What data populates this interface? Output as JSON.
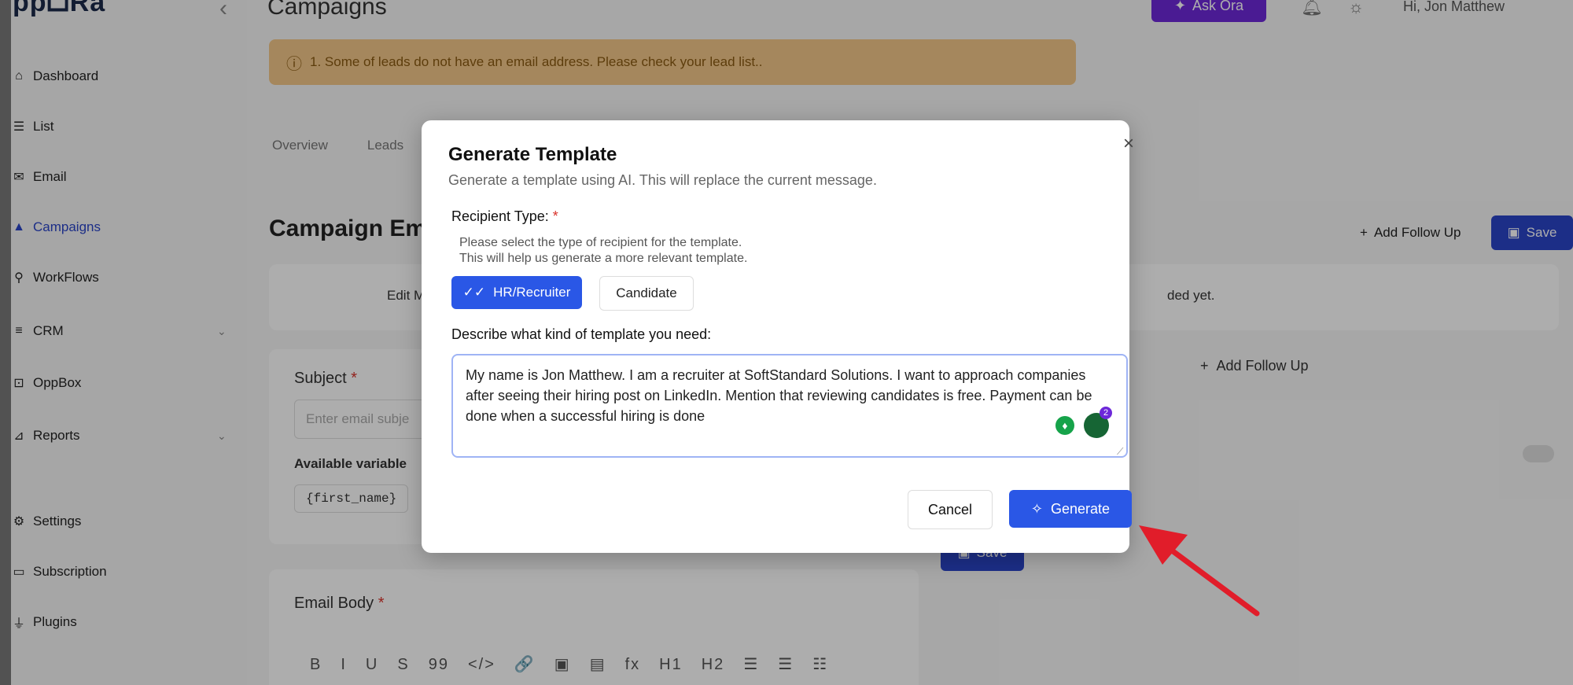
{
  "app": {
    "logo": "ppᗝRa",
    "collapse_icon": "chevron-left-icon"
  },
  "sidebar": {
    "items": [
      {
        "label": "Dashboard",
        "icon": "home-icon"
      },
      {
        "label": "List",
        "icon": "list-icon"
      },
      {
        "label": "Email",
        "icon": "mail-icon"
      },
      {
        "label": "Campaigns",
        "icon": "campaign-icon",
        "active": true
      },
      {
        "label": "WorkFlows",
        "icon": "workflow-icon"
      },
      {
        "label": "CRM",
        "icon": "crm-icon"
      },
      {
        "label": "OppBox",
        "icon": "inbox-icon"
      },
      {
        "label": "Reports",
        "icon": "reports-icon"
      },
      {
        "label": "Settings",
        "icon": "gear-icon"
      },
      {
        "label": "Subscription",
        "icon": "card-icon"
      },
      {
        "label": "Plugins",
        "icon": "plugin-icon"
      }
    ]
  },
  "header": {
    "title": "Campaigns",
    "ask_label": "Ask Ora",
    "greeting": "Hi, Jon Matthew"
  },
  "warning": {
    "text": "1. Some of leads do not have an email address. Please check your lead list.."
  },
  "tabs": [
    "Overview",
    "Leads"
  ],
  "page": {
    "section_title": "Campaign Em",
    "add_follow_up": "Add Follow Up",
    "save": "Save",
    "edit_m": "Edit M",
    "not_added": "ded yet.",
    "subject_label": "Subject",
    "subject_placeholder": "Enter email subje",
    "vars_label": "Available variable",
    "var_chip": "{first_name}",
    "save_mid": "Save",
    "body_label": "Email Body",
    "toolbar": [
      "B",
      "I",
      "U",
      "S",
      "99",
      "</>",
      "🔗",
      "▣",
      "▤",
      "fx",
      "H1",
      "H2",
      "☰",
      "☰",
      "☷"
    ]
  },
  "modal": {
    "title": "Generate Template",
    "subtitle": "Generate a template using AI. This will replace the current message.",
    "recipient_label": "Recipient Type:",
    "help_line1": "Please select the type of recipient for the template.",
    "help_line2": "This will help us generate a more relevant template.",
    "option_hr": "HR/Recruiter",
    "option_candidate": "Candidate",
    "describe_label": "Describe what kind of template you need:",
    "description": "My name is Jon Matthew. I am a recruiter at SoftStandard Solutions. I want to approach companies after seeing their hiring post on LinkedIn. Mention that reviewing candidates is free. Payment can be done when a successful hiring is done",
    "grammarly_badge": "2",
    "cancel": "Cancel",
    "generate": "Generate"
  },
  "colors": {
    "primary": "#2a57e6",
    "accent": "#6d28d9",
    "warning_bg": "#f4c889",
    "arrow": "#e11d2a"
  }
}
